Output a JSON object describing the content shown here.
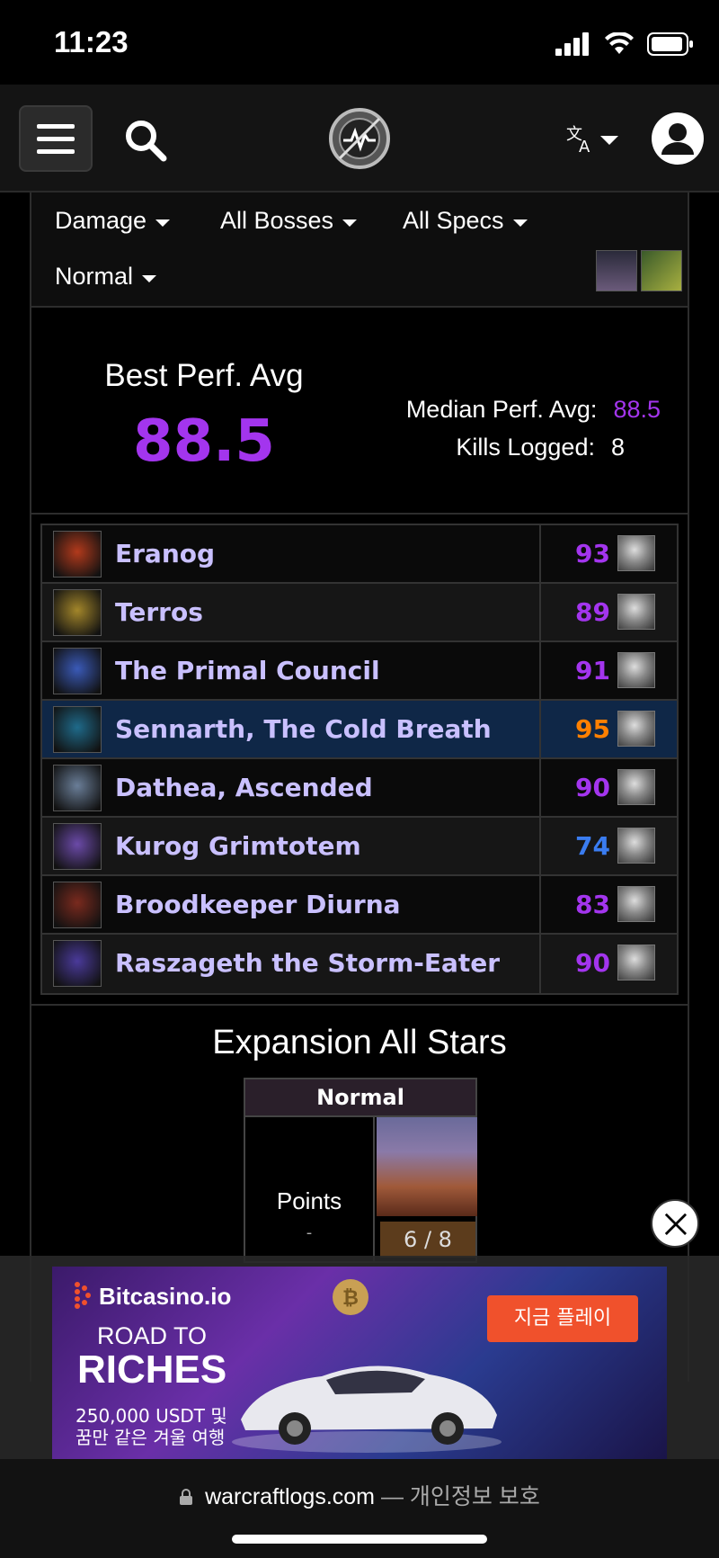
{
  "status_bar": {
    "time": "11:23"
  },
  "filters": {
    "metric": "Damage",
    "bosses": "All Bosses",
    "specs": "All Specs",
    "difficulty": "Normal"
  },
  "summary": {
    "best_label": "Best Perf. Avg",
    "best_value": "88.5",
    "median_label": "Median Perf. Avg:",
    "median_value": "88.5",
    "kills_label": "Kills Logged:",
    "kills_value": "8"
  },
  "bosses": [
    {
      "name": "Eranog",
      "score": "93",
      "score_color": "#a335ee",
      "img_color": "#b23a1c"
    },
    {
      "name": "Terros",
      "score": "89",
      "score_color": "#a335ee",
      "img_color": "#a3862a"
    },
    {
      "name": "The Primal Council",
      "score": "91",
      "score_color": "#a335ee",
      "img_color": "#3a5ab8"
    },
    {
      "name": "Sennarth, The Cold Breath",
      "score": "95",
      "score_color": "#ff8000",
      "img_color": "#1f6a8a"
    },
    {
      "name": "Dathea, Ascended",
      "score": "90",
      "score_color": "#a335ee",
      "img_color": "#6a7e98"
    },
    {
      "name": "Kurog Grimtotem",
      "score": "74",
      "score_color": "#3a7cf0",
      "img_color": "#6b4aa8"
    },
    {
      "name": "Broodkeeper Diurna",
      "score": "83",
      "score_color": "#a335ee",
      "img_color": "#7a2a1e"
    },
    {
      "name": "Raszageth the Storm-Eater",
      "score": "90",
      "score_color": "#a335ee",
      "img_color": "#4a3a9a"
    }
  ],
  "allstars": {
    "title": "Expansion All Stars",
    "column_header": "Normal",
    "points_label": "Points",
    "points_value": "-",
    "progress": "6 / 8"
  },
  "ad": {
    "brand": "Bitcasino.io",
    "line1": "ROAD TO",
    "line2": "RICHES",
    "sub1": "250,000 USDT 및",
    "sub2": "꿈만 같은 겨울 여행",
    "cta": "지금 플레이"
  },
  "url_bar": {
    "domain": "warcraftlogs.com",
    "suffix": "— 개인정보 보호"
  },
  "colors": {
    "epic": "#a335ee",
    "legendary": "#ff8000",
    "rare": "#3a7cf0",
    "boss_name": "#c9c0ff",
    "highlight_row": "#0f2747"
  }
}
